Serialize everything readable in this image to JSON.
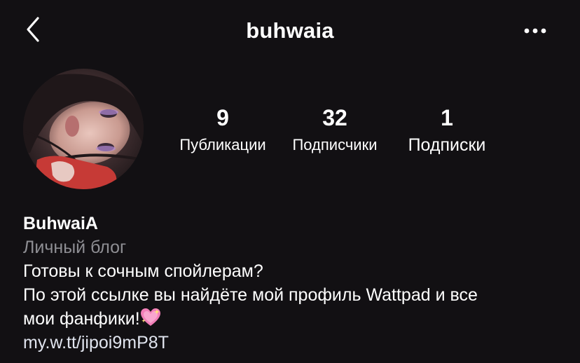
{
  "header": {
    "username": "buhwaia",
    "back_icon": "chevron-left-icon",
    "more_icon": "more-horizontal-icon"
  },
  "profile": {
    "avatar": "avatar-photo"
  },
  "stats": [
    {
      "value": "9",
      "label": "Публикации"
    },
    {
      "value": "32",
      "label": "Подписчики"
    },
    {
      "value": "1",
      "label": "Подписки"
    }
  ],
  "bio": {
    "display_name": "BuhwaiA",
    "category": "Личный блог",
    "line1": "Готовы к сочным спойлерам?",
    "line2": "По этой ссылке вы найдёте мой профиль Wattpad и все",
    "line3": "мои фанфики!",
    "line3_emoji": "sparkling-heart-icon",
    "link": "my.w.tt/jipoi9mP8T"
  },
  "colors": {
    "background": "#121013",
    "text": "#ffffff",
    "secondary_text": "#8e8e93"
  }
}
